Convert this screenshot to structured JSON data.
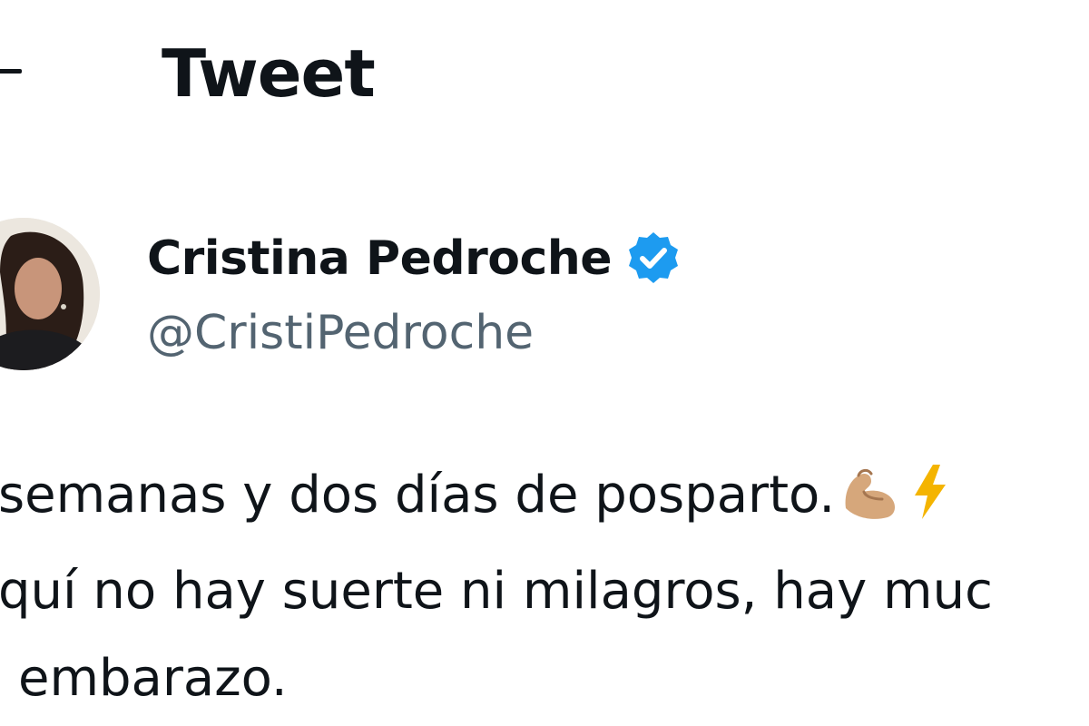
{
  "header": {
    "title": "Tweet"
  },
  "author": {
    "display_name": "Cristina Pedroche",
    "handle": "@CristiPedroche",
    "verified": true,
    "verified_badge_color": "#1d9bf0"
  },
  "tweet": {
    "lines": [
      "semanas y dos días de posparto.",
      "quí no hay suerte ni milagros, hay muc",
      "embarazo."
    ],
    "emojis": [
      "flexed-biceps-icon",
      "lightning-icon"
    ]
  },
  "colors": {
    "text_primary": "#0f1419",
    "text_secondary": "#536471",
    "background": "#ffffff"
  }
}
